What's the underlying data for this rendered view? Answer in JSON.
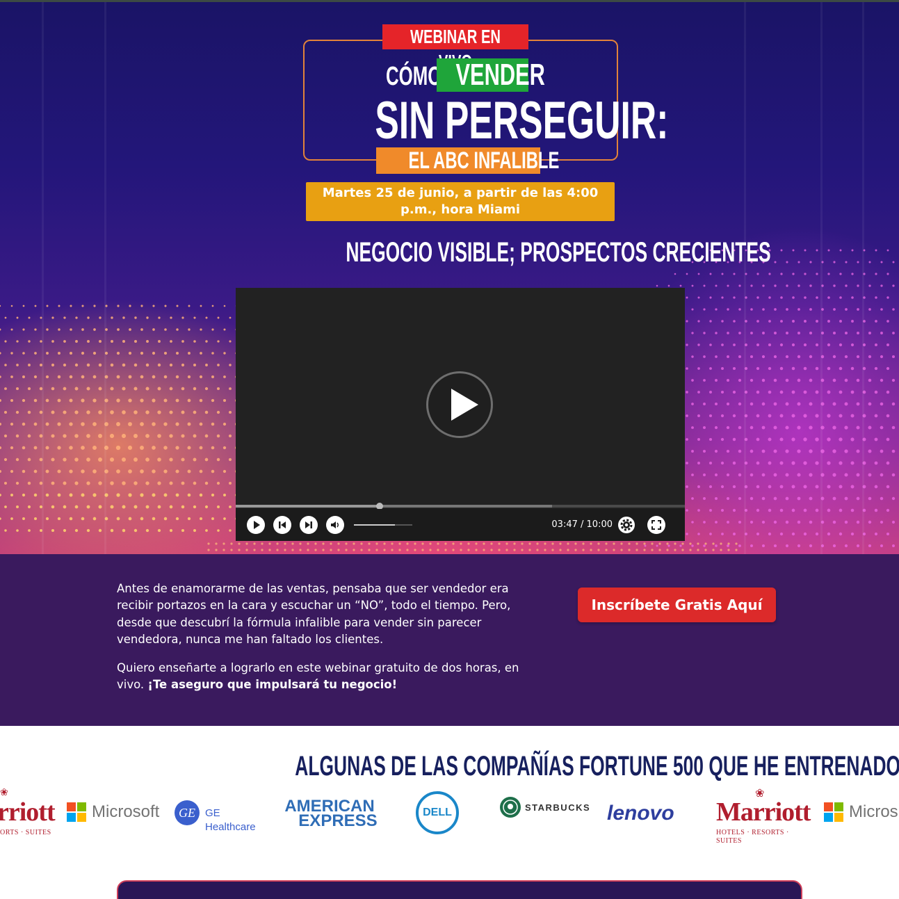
{
  "hero": {
    "badge_live": "WEBINAR EN VIVO",
    "title_como": "CÓMO",
    "title_vender": "VENDER",
    "title_main": "SIN PERSEGUIR:",
    "title_abc": "EL ABC INFALIBLE",
    "date_line1": "Martes 25 de junio, a partir de las 4:00",
    "date_line2": "p.m., hora Miami",
    "subheading": "NEGOCIO VISIBLE; PROSPECTOS CRECIENTES"
  },
  "video": {
    "current_time": "03:47",
    "separator": " / ",
    "total_time": "10:00",
    "progress": 0.32,
    "buffered": 0.705,
    "volume": 0.7,
    "icons": [
      "play-icon",
      "skip-back-icon",
      "skip-forward-icon",
      "volume-icon",
      "settings-icon",
      "fullscreen-icon"
    ]
  },
  "intro": {
    "paragraph1": "Antes de enamorarme de las ventas, pensaba que ser vendedor era recibir portazos en la cara y escuchar un “NO”, todo el tiempo. Pero, desde que descubrí la fórmula infalible para vender sin parecer vendedora, nunca me han faltado los clientes.",
    "paragraph2_plain": "Quiero enseñarte a lograrlo en este webinar gratuito de dos horas, en vivo. ",
    "paragraph2_bold": "¡Te aseguro que impulsará tu negocio!",
    "cta_label": "Inscríbete Gratis Aquí"
  },
  "logos": {
    "heading": "ALGUNAS DE LAS COMPAÑÍAS FORTUNE 500 QUE HE ENTRENADO",
    "marriott_partial_left": "rriott",
    "marriott_partial_left_sub": "ORTS · SUITES",
    "microsoft": "Microsoft",
    "ge": "GE Healthcare",
    "ge_mark": "GE",
    "amex_line1": "AMERICAN",
    "amex_line2": "EXPRESS",
    "dell": "DELL",
    "starbucks": "STARBUCKS",
    "lenovo": "lenovo",
    "marriott": "Marriott",
    "marriott_sub": "HOTELS · RESORTS · SUITES",
    "microsoft_partial": "Micros"
  },
  "colors": {
    "live_red": "#e52429",
    "vender_green": "#1fa53a",
    "abc_orange": "#f08a2a",
    "date_gold": "#e8a012",
    "intro_purple": "#3a1a5e",
    "cta_red": "#dc2a2a",
    "heading_navy": "#17205e"
  }
}
